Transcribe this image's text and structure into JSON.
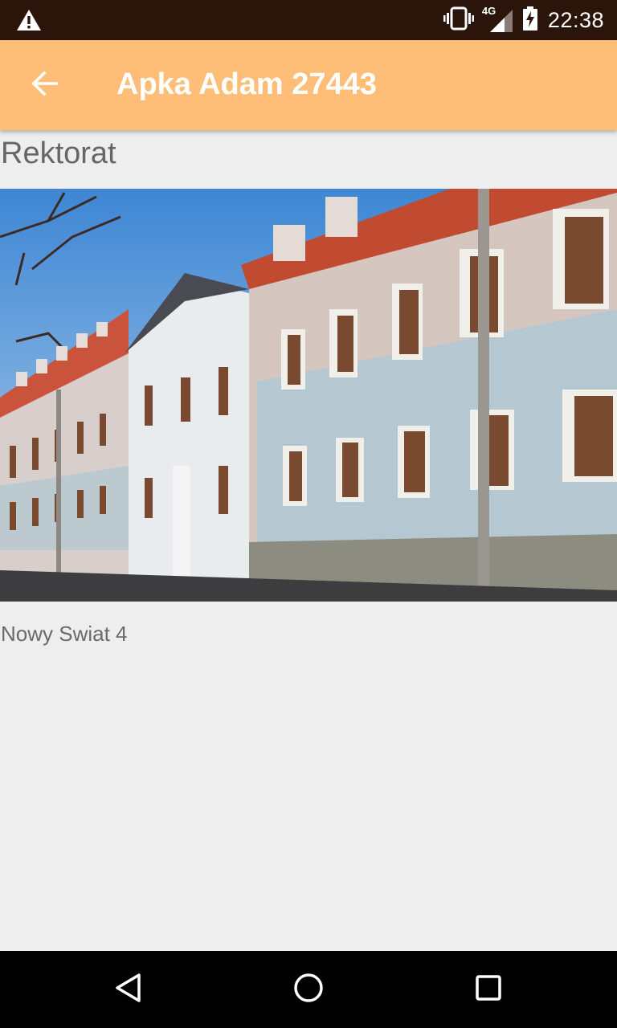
{
  "status_bar": {
    "alert_icon": "warning-icon",
    "vibrate_icon": "vibrate-icon",
    "network_label": "4G",
    "signal_icon": "signal-icon",
    "battery_icon": "battery-charging-icon",
    "time": "22:38"
  },
  "app_bar": {
    "back_icon": "arrow-back-icon",
    "title": "Apka Adam 27443",
    "color": "#ffbe78"
  },
  "content": {
    "heading": "Rektorat",
    "image_description": "building-photo",
    "address": "Nowy Swiat 4"
  },
  "nav_bar": {
    "back_icon": "nav-back-icon",
    "home_icon": "nav-home-icon",
    "recents_icon": "nav-recents-icon"
  }
}
